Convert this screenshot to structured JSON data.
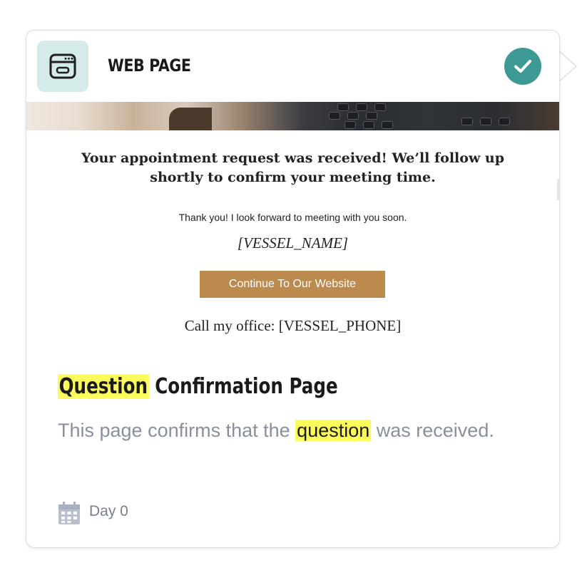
{
  "header": {
    "icon": "browser-window-icon",
    "title": "WEB PAGE",
    "status_icon": "check-icon"
  },
  "preview": {
    "hero_image": "desk-phone-photo",
    "heading": "Your appointment request was received! We’ll follow up shortly to confirm your meeting time.",
    "thanks_text": "Thank you! I look forward to meeting with you soon.",
    "vessel_name": "[VESSEL_NAME]",
    "button_label": "Continue To Our Website",
    "call_office": "Call my office: [VESSEL_PHONE]"
  },
  "card": {
    "title_highlight": "Question",
    "title_rest": " Confirmation Page",
    "description_before": "This page confirms that the ",
    "description_highlight": "question",
    "description_after": " was received."
  },
  "footer": {
    "icon": "calendar-icon",
    "day_label": "Day 0"
  },
  "colors": {
    "accent_teal": "#3d9994",
    "icon_bg": "#d4ebea",
    "button": "#bd8a4d",
    "highlight": "#fcfc5c"
  }
}
